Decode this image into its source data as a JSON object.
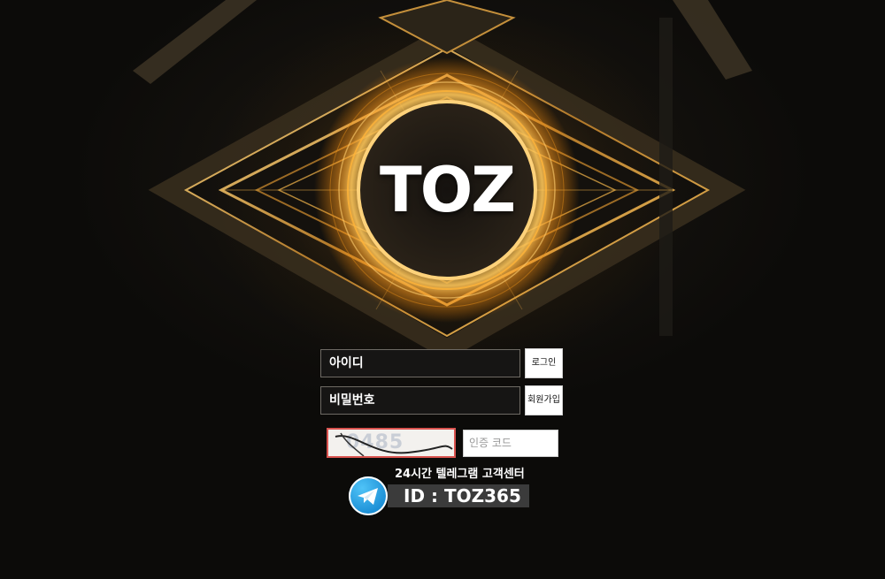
{
  "brand": {
    "logo_text": "TOZ",
    "accent_color": "#d4a24a",
    "glow_color": "#f3b341"
  },
  "login_form": {
    "username_placeholder": "아이디",
    "password_placeholder": "비밀번호",
    "login_button": "로그인",
    "signup_button": "회원가입",
    "captcha_text": "0485",
    "code_placeholder": "인증 코드"
  },
  "support": {
    "title": "24시간 텔레그램 고객센터",
    "telegram_id": "ID : TOZ365",
    "icon": "telegram-icon",
    "icon_color": "#2aa1e3"
  }
}
